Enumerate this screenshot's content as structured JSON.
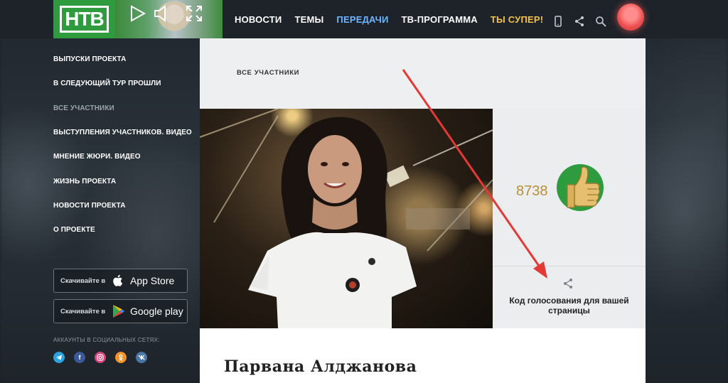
{
  "header": {
    "logo_text": "НТВ",
    "nav": [
      {
        "label": "НОВОСТИ",
        "state": "normal"
      },
      {
        "label": "ТЕМЫ",
        "state": "normal"
      },
      {
        "label": "ПЕРЕДАЧИ",
        "state": "active"
      },
      {
        "label": "ТВ-ПРОГРАММА",
        "state": "normal"
      },
      {
        "label": "ТЫ СУПЕР!",
        "state": "special"
      }
    ],
    "icons": [
      "mobile-icon",
      "share-icon",
      "search-icon"
    ]
  },
  "sidebar": {
    "items": [
      {
        "label": "ВЫПУСКИ ПРОЕКТА",
        "active": false
      },
      {
        "label": "В СЛЕДУЮЩИЙ ТУР ПРОШЛИ",
        "active": false
      },
      {
        "label": "ВСЕ УЧАСТНИКИ",
        "active": true
      },
      {
        "label": "ВЫСТУПЛЕНИЯ УЧАСТНИКОВ. ВИДЕО",
        "active": false
      },
      {
        "label": "МНЕНИЕ ЖЮРИ. ВИДЕО",
        "active": false
      },
      {
        "label": "ЖИЗНЬ ПРОЕКТА",
        "active": false
      },
      {
        "label": "НОВОСТИ ПРОЕКТА",
        "active": false
      },
      {
        "label": "О ПРОЕКТЕ",
        "active": false
      }
    ],
    "appstore": {
      "small": "Скачивайте в",
      "big": "App Store"
    },
    "googleplay": {
      "small": "Скачивайте в",
      "big": "Google play"
    },
    "social_title": "АККАУНТЫ В СОЦИАЛЬНЫХ СЕТЯХ:",
    "social": [
      {
        "icon": "telegram-icon",
        "color": "#2aa3dc"
      },
      {
        "icon": "facebook-icon",
        "color": "#3b5998"
      },
      {
        "icon": "instagram-icon",
        "color": "#d3457b"
      },
      {
        "icon": "odnoklassniki-icon",
        "color": "#f2922b"
      },
      {
        "icon": "vk-icon",
        "color": "#4a76a8"
      }
    ]
  },
  "content": {
    "breadcrumb": "ВСЕ УЧАСТНИКИ",
    "vote_count": "8738",
    "vote_code_label": "Код голосования для вашей страницы",
    "participant_name": "Парвана Алджанова"
  },
  "colors": {
    "brand_green": "#2e9b3f",
    "nav_active": "#6fb5ff",
    "nav_special": "#f3c34a",
    "arrow_red": "#e53935",
    "vote_gold": "#b8903a"
  }
}
